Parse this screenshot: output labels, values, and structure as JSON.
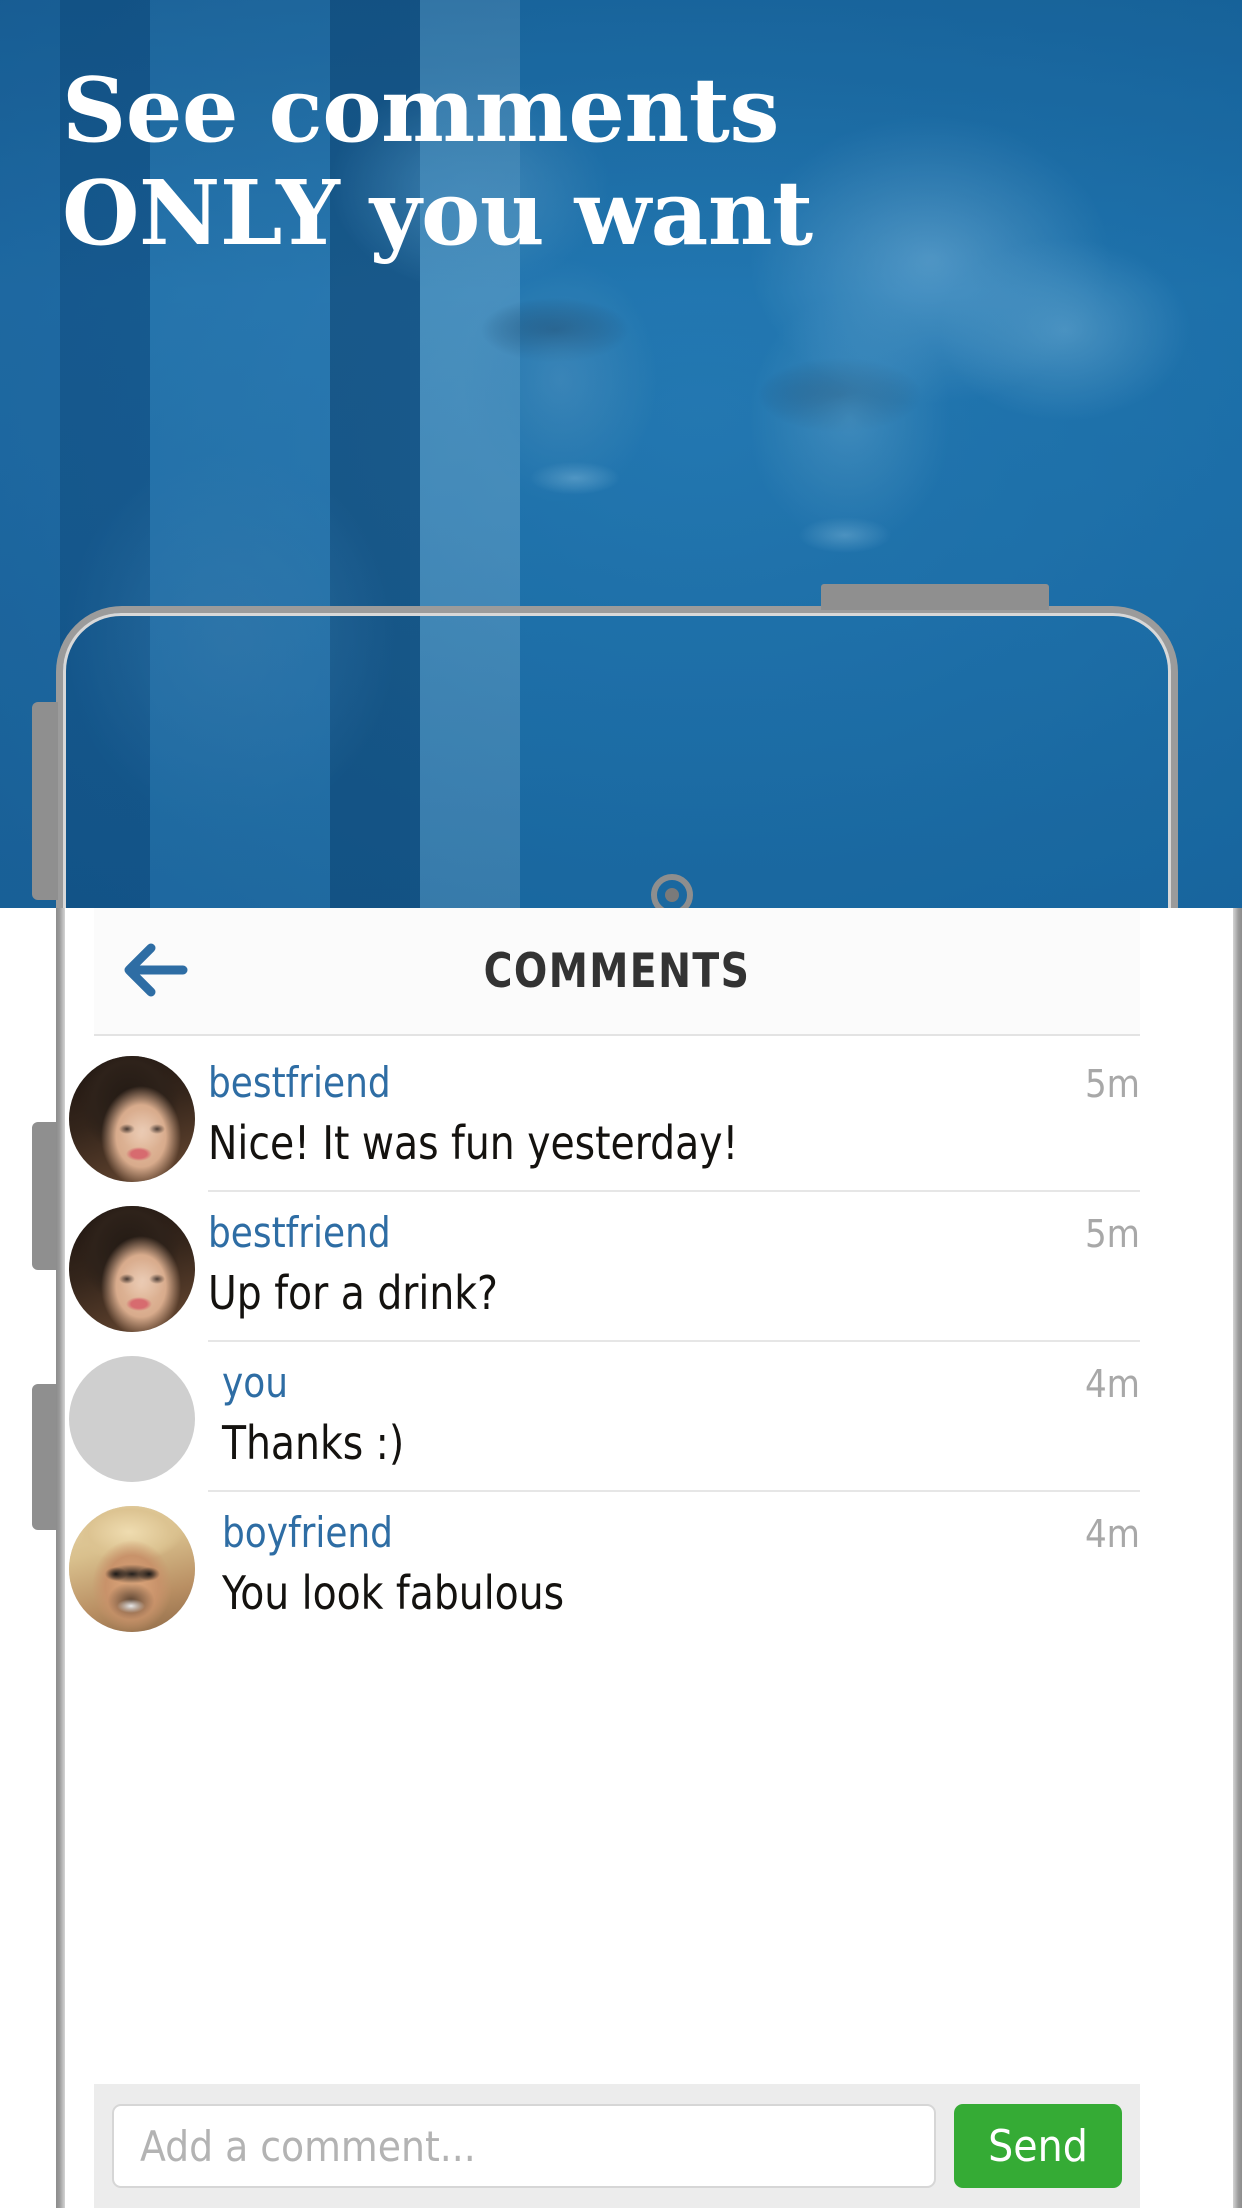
{
  "hero": {
    "headline": "See comments ONLY you want",
    "overlay_color": "#2a8ec3",
    "text_color": "#ffffff"
  },
  "phone": {
    "frame_color": "#9b9b9b",
    "camera_icon": "front-camera-icon",
    "speaker_icon": "earpiece-speaker-icon",
    "sensor_icon": "proximity-sensor-icon",
    "side_buttons": [
      "volume-up",
      "volume-down",
      "power"
    ]
  },
  "screen": {
    "header": {
      "back_icon": "back-arrow-icon",
      "title": "COMMENTS",
      "title_color": "#333333",
      "back_color": "#2e6da4"
    },
    "comments": [
      {
        "user": "bestfriend",
        "text": "Nice! It was fun yesterday!",
        "time": "5m",
        "avatar": "bestfriend-avatar"
      },
      {
        "user": "bestfriend",
        "text": "Up for a drink?",
        "time": "5m",
        "avatar": "bestfriend-avatar"
      },
      {
        "user": "you",
        "text": "Thanks :)",
        "time": "4m",
        "avatar": "you-avatar"
      },
      {
        "user": "boyfriend",
        "text": "You look fabulous",
        "time": "4m",
        "avatar": "boyfriend-avatar"
      }
    ],
    "composer": {
      "placeholder": "Add a comment...",
      "value": "",
      "send_label": "Send",
      "send_color": "#35ab35"
    },
    "username_color": "#2e6da4",
    "time_color": "#a8a8a8"
  }
}
